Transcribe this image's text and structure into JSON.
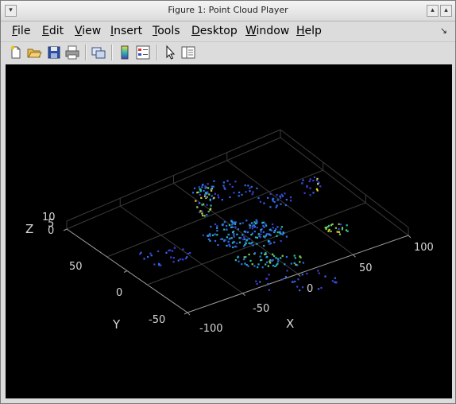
{
  "window": {
    "title": "Figure 1: Point Cloud Player"
  },
  "menu": {
    "file": {
      "key": "F",
      "rest": "ile"
    },
    "edit": {
      "key": "E",
      "rest": "dit"
    },
    "view": {
      "key": "V",
      "rest": "iew"
    },
    "insert": {
      "key": "I",
      "rest": "nsert"
    },
    "tools": {
      "key": "T",
      "rest": "ools"
    },
    "desktop": {
      "key": "D",
      "rest": "esktop"
    },
    "window": {
      "key": "W",
      "rest": "indow"
    },
    "help": {
      "key": "H",
      "rest": "elp"
    }
  },
  "toolbar": [
    "new-figure",
    "open-file",
    "save",
    "print",
    "link-plot",
    "colorbar",
    "legend",
    "select",
    "property-inspector"
  ],
  "axes": {
    "xlabel": "X",
    "ylabel": "Y",
    "zlabel": "Z",
    "x_ticks": [
      "-100",
      "-50",
      "0",
      "50",
      "100"
    ],
    "y_ticks": [
      "-50",
      "0",
      "50"
    ],
    "z_ticks": [
      "0",
      "5",
      "10"
    ],
    "tick_color": "#d7d7d7",
    "grid_color": "#3b3b3b"
  },
  "colormap": [
    "#3d3fd4",
    "#2f6cf0",
    "#23a9d9",
    "#29c2a3",
    "#8ad04a",
    "#e6d42a"
  ]
}
